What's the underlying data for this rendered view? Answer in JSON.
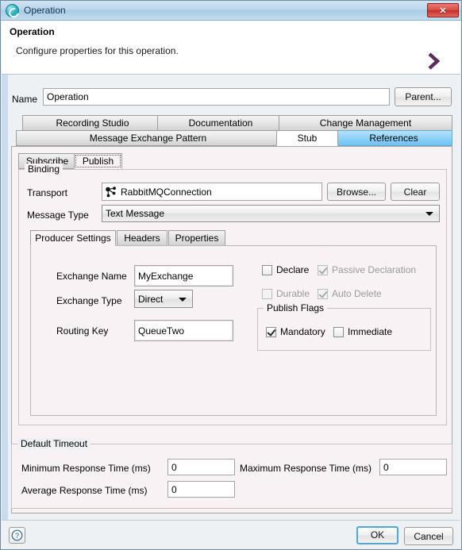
{
  "window": {
    "title": "Operation",
    "icon": "operation-circle-icon",
    "close_label": "✕"
  },
  "header": {
    "title": "Operation",
    "description": "Configure properties for this operation.",
    "arrow_icon": "chevron-right-icon",
    "arrow_color": "#5c2e5c"
  },
  "name_row": {
    "label": "Name",
    "value": "Operation",
    "parent_button": "Parent..."
  },
  "top_tabs_row1": [
    {
      "label": "Recording Studio",
      "selected": false,
      "style": "normal"
    },
    {
      "label": "Documentation",
      "selected": false,
      "style": "normal"
    },
    {
      "label": "Change Management",
      "selected": false,
      "style": "normal"
    }
  ],
  "top_tabs_row2": [
    {
      "label": "Message Exchange Pattern",
      "selected": false,
      "style": "normal"
    },
    {
      "label": "Stub",
      "selected": true,
      "style": "normal"
    },
    {
      "label": "References",
      "selected": false,
      "style": "blue"
    }
  ],
  "sub_tabs": [
    {
      "label": "Subscribe",
      "selected": false
    },
    {
      "label": "Publish",
      "selected": true
    }
  ],
  "binding": {
    "group_title": "Binding",
    "transport_label": "Transport",
    "transport_value": "RabbitMQConnection",
    "transport_icon": "connection-node-icon",
    "browse_button": "Browse...",
    "clear_button": "Clear",
    "message_type_label": "Message Type",
    "message_type_value": "Text Message"
  },
  "inner_tabs": [
    {
      "label": "Producer Settings",
      "selected": true
    },
    {
      "label": "Headers",
      "selected": false
    },
    {
      "label": "Properties",
      "selected": false
    }
  ],
  "producer_settings": {
    "exchange_name_label": "Exchange Name",
    "exchange_name_value": "MyExchange",
    "exchange_type_label": "Exchange Type",
    "exchange_type_value": "Direct",
    "routing_key_label": "Routing Key",
    "routing_key_value": "QueueTwo",
    "checkboxes": [
      {
        "label": "Declare",
        "checked": false,
        "enabled": true
      },
      {
        "label": "Passive Declaration",
        "checked": true,
        "enabled": false
      },
      {
        "label": "Durable",
        "checked": false,
        "enabled": false
      },
      {
        "label": "Auto Delete",
        "checked": true,
        "enabled": false
      }
    ],
    "publish_flags": {
      "group_title": "Publish Flags",
      "flags": [
        {
          "label": "Mandatory",
          "checked": true,
          "enabled": true
        },
        {
          "label": "Immediate",
          "checked": false,
          "enabled": true
        }
      ]
    }
  },
  "default_timeout": {
    "group_title": "Default Timeout",
    "minimum_label": "Minimum Response Time (ms)",
    "minimum_value": "0",
    "maximum_label": "Maximum Response Time (ms)",
    "maximum_value": "0",
    "average_label": "Average Response Time (ms)",
    "average_value": "0"
  },
  "footer": {
    "help_icon": "help-question-icon",
    "ok_button": "OK",
    "cancel_button": "Cancel"
  }
}
